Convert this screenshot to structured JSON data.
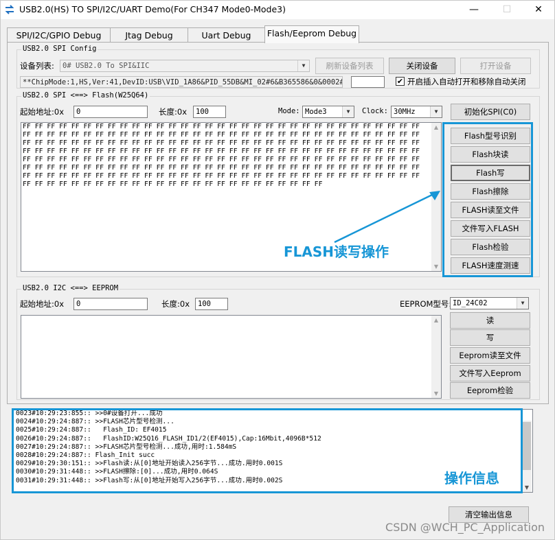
{
  "window": {
    "title": "USB2.0(HS) TO SPI/I2C/UART Demo(For CH347 Mode0-Mode3)",
    "minimize": "—",
    "maximize": "☐",
    "close": "✕"
  },
  "tabs": [
    "SPI/I2C/GPIO Debug",
    "Jtag Debug",
    "Uart Debug",
    "Flash/Eeprom Debug"
  ],
  "spi_config": {
    "title": "USB2.0 SPI Config",
    "device_label": "设备列表:",
    "device_value": "0# USB2.0 To SPI&IIC",
    "refresh_btn": "刷新设备列表",
    "close_btn": "关闭设备",
    "open_btn": "打开设备",
    "info": "**ChipMode:1,HS,Ver:41,DevID:USB\\VID_1A86&PID_55DB&MI_02#6&B365586&0&0002#",
    "auto_label": "开启插入自动打开和移除自动关闭",
    "auto_checked": "✔"
  },
  "flash": {
    "title": "USB2.0 SPI <==> Flash(W25Q64)",
    "addr_label": "起始地址:0x",
    "addr_value": "0",
    "len_label": "长度:0x",
    "len_value": "100",
    "mode_label": "Mode:",
    "mode_value": "Mode3",
    "clock_label": "Clock:",
    "clock_value": "30MHz",
    "init_btn": "初始化SPI(C0)",
    "hex_lines": [
      "FF FF FF FF FF FF FF FF FF FF FF FF FF FF FF FF FF FF FF FF FF FF FF FF FF FF FF FF FF FF FF FF FF",
      "FF FF FF FF FF FF FF FF FF FF FF FF FF FF FF FF FF FF FF FF FF FF FF FF FF FF FF FF FF FF FF FF FF",
      "FF FF FF FF FF FF FF FF FF FF FF FF FF FF FF FF FF FF FF FF FF FF FF FF FF FF FF FF FF FF FF FF FF",
      "FF FF FF FF FF FF FF FF FF FF FF FF FF FF FF FF FF FF FF FF FF FF FF FF FF FF FF FF FF FF FF FF FF",
      "FF FF FF FF FF FF FF FF FF FF FF FF FF FF FF FF FF FF FF FF FF FF FF FF FF FF FF FF FF FF FF FF FF",
      "FF FF FF FF FF FF FF FF FF FF FF FF FF FF FF FF FF FF FF FF FF FF FF FF FF FF FF FF FF FF FF FF FF",
      "FF FF FF FF FF FF FF FF FF FF FF FF FF FF FF FF FF FF FF FF FF FF FF FF FF FF FF FF FF FF FF FF FF",
      "FF FF FF FF FF FF FF FF FF FF FF FF FF FF FF FF FF FF FF FF FF FF FF FF FF"
    ],
    "buttons": [
      "Flash型号识别",
      "Flash块读",
      "Flash写",
      "Flash擦除",
      "FLASH读至文件",
      "文件写入FLASH",
      "Flash检验",
      "FLASH速度测速"
    ],
    "annotation": "FLASH读写操作"
  },
  "eeprom": {
    "title": "USB2.0 I2C <==> EEPROM",
    "addr_label": "起始地址:0x",
    "addr_value": "0",
    "len_label": "长度:0x",
    "len_value": "100",
    "type_label": "EEPROM型号:",
    "type_value": "ID_24C02",
    "buttons": [
      "读",
      "写",
      "Eeprom读至文件",
      "文件写入Eeprom",
      "Eeprom检验"
    ]
  },
  "log": {
    "lines": [
      "0023#10:29:23:855:: >>0#设备打开...成功",
      "0024#10:29:24:887:: >>FLASH芯片型号检测...",
      "0025#10:29:24:887::   Flash_ID: EF4015",
      "0026#10:29:24:887::   FlashID:W25Q16_FLASH_ID1/2(EF4015),Cap:16Mbit,4096B*512",
      "0027#10:29:24:887:: >>FLASH芯片型号检测...成功,用时:1.584mS",
      "0028#10:29:24:887:: Flash_Init succ",
      "0029#10:29:30:151:: >>Flash读:从[0]地址开始读入256字节...成功.用时0.001S",
      "0030#10:29:31:448:: >>FLASH擦除:[0]...成功,用时0.064S",
      "0031#10:29:31:448:: >>Flash写:从[0]地址开始写入256字节...成功.用时0.002S"
    ],
    "annotation": "操作信息",
    "clear_btn": "清空输出信息"
  },
  "watermark": "CSDN @WCH_PC_Application",
  "accent": "#1796d6"
}
